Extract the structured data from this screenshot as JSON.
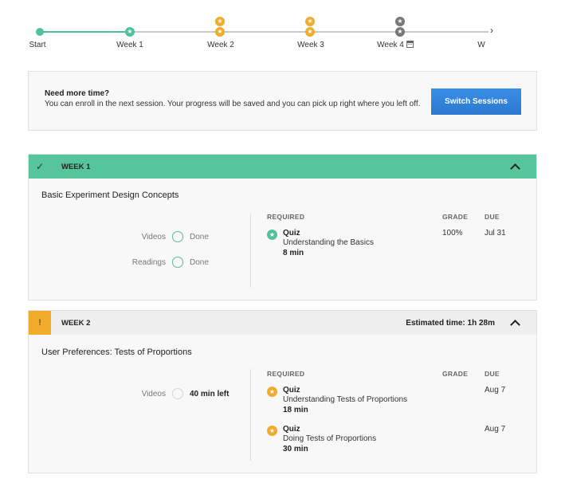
{
  "timeline": {
    "nodes": [
      {
        "label": "Start",
        "state": "done"
      },
      {
        "label": "Week 1",
        "state": "done",
        "icons": [
          "star-icon"
        ]
      },
      {
        "label": "Week 2",
        "state": "due",
        "icons": [
          "star-icon",
          "star-icon"
        ]
      },
      {
        "label": "Week 3",
        "state": "due",
        "icons": [
          "star-icon",
          "star-icon"
        ]
      },
      {
        "label": "Week 4",
        "state": "upcoming",
        "icons": [
          "star-icon",
          "star-icon"
        ],
        "extra_icon": "calendar-icon"
      },
      {
        "label": "W",
        "state": "upcoming"
      }
    ],
    "next_arrow": "›",
    "colors": {
      "done": "#52c09b",
      "due": "#f2ac2c",
      "upcoming": "#777777",
      "track": "#c8c8c8"
    }
  },
  "banner": {
    "title": "Need more time?",
    "text": "You can enroll in the next session. Your progress will be saved and you can pick up right where you left off.",
    "button_label": "Switch Sessions",
    "button_color": "#2d7fd9"
  },
  "weeks": [
    {
      "status_icon": "✓",
      "status": "complete",
      "header": "WEEK 1",
      "header_color": "#57c59c",
      "module_title": "Basic Experiment Design Concepts",
      "progress": [
        {
          "label": "Videos",
          "status": "Done"
        },
        {
          "label": "Readings",
          "status": "Done"
        }
      ],
      "columns": {
        "required": "REQUIRED",
        "grade": "GRADE",
        "due": "DUE"
      },
      "items": [
        {
          "type": "Quiz",
          "name": "Understanding the Basics",
          "duration": "8 min",
          "grade": "100%",
          "due": "Jul 31",
          "icon": "star-icon",
          "icon_color": "#52c09b"
        }
      ]
    },
    {
      "status_icon": "!",
      "status": "warning",
      "header": "WEEK 2",
      "header_color": "#eeeeee",
      "estimated_time": "Estimated time: 1h 28m",
      "module_title": "User Preferences: Tests of Proportions",
      "progress": [
        {
          "label": "Videos",
          "status": "40 min left"
        }
      ],
      "columns": {
        "required": "REQUIRED",
        "grade": "GRADE",
        "due": "DUE"
      },
      "items": [
        {
          "type": "Quiz",
          "name": "Understanding Tests of Proportions",
          "duration": "18 min",
          "grade": "",
          "due": "Aug 7",
          "icon": "star-icon",
          "icon_color": "#f2ac2c"
        },
        {
          "type": "Quiz",
          "name": "Doing Tests of Proportions",
          "duration": "30 min",
          "grade": "",
          "due": "Aug 7",
          "icon": "star-icon",
          "icon_color": "#f2ac2c"
        }
      ]
    }
  ]
}
